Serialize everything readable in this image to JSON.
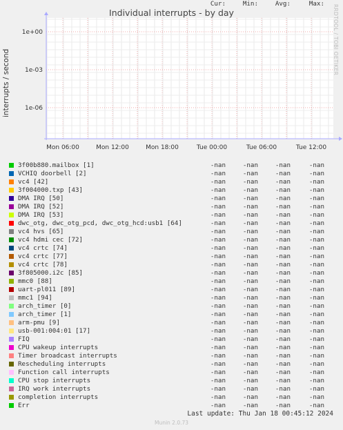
{
  "chart": {
    "title": "Individual interrupts - by day",
    "ylabel": "interrupts / second",
    "side_note": "RRDTOOL / TOBI OETIKER",
    "y_ticks": [
      "1e+00",
      "1e-03",
      "1e-06"
    ],
    "x_ticks": [
      "Mon 06:00",
      "Mon 12:00",
      "Mon 18:00",
      "Tue 00:00",
      "Tue 06:00",
      "Tue 12:00"
    ]
  },
  "chart_data": {
    "type": "line",
    "title": "Individual interrupts - by day",
    "ylabel": "interrupts / second",
    "y_scale": "log",
    "x_ticks": [
      "Mon 06:00",
      "Mon 12:00",
      "Mon 18:00",
      "Tue 00:00",
      "Tue 06:00",
      "Tue 12:00"
    ],
    "y_ticks": [
      "1e+00",
      "1e-03",
      "1e-06"
    ],
    "series": [],
    "grid": true
  },
  "legend": {
    "headers": {
      "cur": "Cur:",
      "min": "Min:",
      "avg": "Avg:",
      "max": "Max:"
    },
    "rows": [
      {
        "label": "3f00b880.mailbox [1]",
        "color": "#00cc00",
        "cur": "-nan",
        "min": "-nan",
        "avg": "-nan",
        "max": "-nan"
      },
      {
        "label": "VCHIQ doorbell [2]",
        "color": "#0066b3",
        "cur": "-nan",
        "min": "-nan",
        "avg": "-nan",
        "max": "-nan"
      },
      {
        "label": "vc4 [42]",
        "color": "#ff8000",
        "cur": "-nan",
        "min": "-nan",
        "avg": "-nan",
        "max": "-nan"
      },
      {
        "label": "3f004000.txp [43]",
        "color": "#ffcc00",
        "cur": "-nan",
        "min": "-nan",
        "avg": "-nan",
        "max": "-nan"
      },
      {
        "label": "DMA IRQ [50]",
        "color": "#330099",
        "cur": "-nan",
        "min": "-nan",
        "avg": "-nan",
        "max": "-nan"
      },
      {
        "label": "DMA IRQ [52]",
        "color": "#990099",
        "cur": "-nan",
        "min": "-nan",
        "avg": "-nan",
        "max": "-nan"
      },
      {
        "label": "DMA IRQ [53]",
        "color": "#ccff00",
        "cur": "-nan",
        "min": "-nan",
        "avg": "-nan",
        "max": "-nan"
      },
      {
        "label": "dwc_otg, dwc_otg_pcd, dwc_otg_hcd:usb1 [64]",
        "color": "#ff0000",
        "cur": "-nan",
        "min": "-nan",
        "avg": "-nan",
        "max": "-nan"
      },
      {
        "label": "vc4 hvs [65]",
        "color": "#808080",
        "cur": "-nan",
        "min": "-nan",
        "avg": "-nan",
        "max": "-nan"
      },
      {
        "label": "vc4 hdmi cec [72]",
        "color": "#008f00",
        "cur": "-nan",
        "min": "-nan",
        "avg": "-nan",
        "max": "-nan"
      },
      {
        "label": "vc4 crtc [74]",
        "color": "#00487d",
        "cur": "-nan",
        "min": "-nan",
        "avg": "-nan",
        "max": "-nan"
      },
      {
        "label": "vc4 crtc [77]",
        "color": "#b35a00",
        "cur": "-nan",
        "min": "-nan",
        "avg": "-nan",
        "max": "-nan"
      },
      {
        "label": "vc4 crtc [78]",
        "color": "#b38f00",
        "cur": "-nan",
        "min": "-nan",
        "avg": "-nan",
        "max": "-nan"
      },
      {
        "label": "3f805000.i2c [85]",
        "color": "#6b006b",
        "cur": "-nan",
        "min": "-nan",
        "avg": "-nan",
        "max": "-nan"
      },
      {
        "label": "mmc0 [88]",
        "color": "#8fb300",
        "cur": "-nan",
        "min": "-nan",
        "avg": "-nan",
        "max": "-nan"
      },
      {
        "label": "uart-pl011 [89]",
        "color": "#b30000",
        "cur": "-nan",
        "min": "-nan",
        "avg": "-nan",
        "max": "-nan"
      },
      {
        "label": "mmc1 [94]",
        "color": "#bebebe",
        "cur": "-nan",
        "min": "-nan",
        "avg": "-nan",
        "max": "-nan"
      },
      {
        "label": "arch_timer [0]",
        "color": "#80ff80",
        "cur": "-nan",
        "min": "-nan",
        "avg": "-nan",
        "max": "-nan"
      },
      {
        "label": "arch_timer [1]",
        "color": "#80c9ff",
        "cur": "-nan",
        "min": "-nan",
        "avg": "-nan",
        "max": "-nan"
      },
      {
        "label": "arm-pmu [9]",
        "color": "#ffc080",
        "cur": "-nan",
        "min": "-nan",
        "avg": "-nan",
        "max": "-nan"
      },
      {
        "label": "usb-001:004:01 [17]",
        "color": "#ffe680",
        "cur": "-nan",
        "min": "-nan",
        "avg": "-nan",
        "max": "-nan"
      },
      {
        "label": "FIQ",
        "color": "#aa80ff",
        "cur": "-nan",
        "min": "-nan",
        "avg": "-nan",
        "max": "-nan"
      },
      {
        "label": "CPU wakeup interrupts",
        "color": "#ee00cc",
        "cur": "-nan",
        "min": "-nan",
        "avg": "-nan",
        "max": "-nan"
      },
      {
        "label": "Timer broadcast interrupts",
        "color": "#ff8080",
        "cur": "-nan",
        "min": "-nan",
        "avg": "-nan",
        "max": "-nan"
      },
      {
        "label": "Rescheduling interrupts",
        "color": "#666600",
        "cur": "-nan",
        "min": "-nan",
        "avg": "-nan",
        "max": "-nan"
      },
      {
        "label": "Function call interrupts",
        "color": "#ffbfff",
        "cur": "-nan",
        "min": "-nan",
        "avg": "-nan",
        "max": "-nan"
      },
      {
        "label": "CPU stop interrupts",
        "color": "#00ffcc",
        "cur": "-nan",
        "min": "-nan",
        "avg": "-nan",
        "max": "-nan"
      },
      {
        "label": "IRQ work interrupts",
        "color": "#cc6699",
        "cur": "-nan",
        "min": "-nan",
        "avg": "-nan",
        "max": "-nan"
      },
      {
        "label": "completion interrupts",
        "color": "#999900",
        "cur": "-nan",
        "min": "-nan",
        "avg": "-nan",
        "max": "-nan"
      },
      {
        "label": "Err",
        "color": "#00cc00",
        "cur": "-nan",
        "min": "-nan",
        "avg": "-nan",
        "max": "-nan"
      }
    ]
  },
  "footer": {
    "last_update": "Last update: Thu Jan 18 00:45:12 2024",
    "munin": "Munin 2.0.73"
  }
}
